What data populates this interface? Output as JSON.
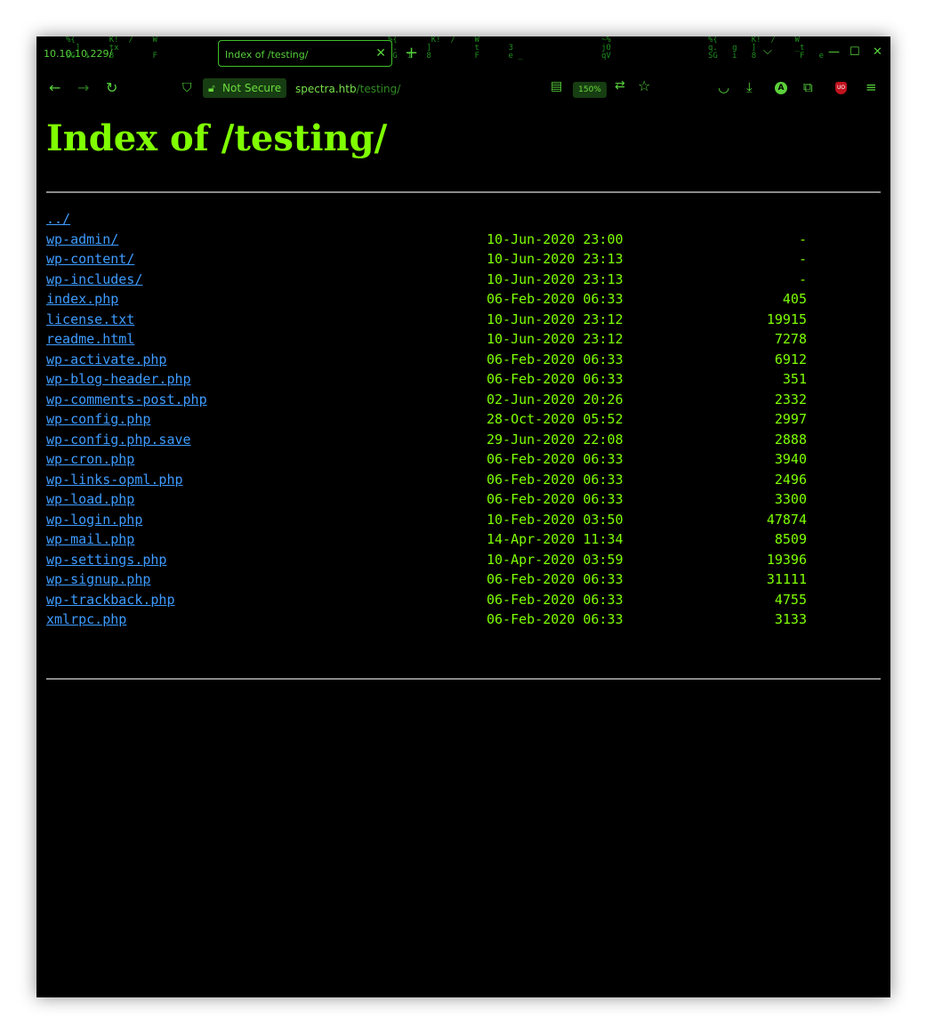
{
  "tabs": {
    "inactive_title": "10.10.10.229/",
    "active_title": "Index of /testing/"
  },
  "icons": {
    "back": "back-arrow-icon",
    "forward": "forward-arrow-icon",
    "reload": "reload-icon",
    "shield": "tracking-protection-shield-icon",
    "lock": "insecure-lock-icon",
    "reader": "reader-view-icon",
    "translate": "translate-icon",
    "bookmark": "star-icon",
    "pocket": "pocket-icon",
    "downloads": "download-icon",
    "account": "account-avatar-icon",
    "extensions": "extensions-icon",
    "ublock": "ublock-origin-icon",
    "menu": "hamburger-menu-icon"
  },
  "navbar": {
    "security_label": "Not Secure",
    "url_host": "spectra.htb",
    "url_path": "/testing/",
    "zoom": "150%",
    "avatar_letter": "A",
    "ublock_label": "UO"
  },
  "page": {
    "heading": "Index of /testing/",
    "parent_link": "../",
    "entries": [
      {
        "name": "wp-admin/",
        "date": "10-Jun-2020 23:00",
        "size": "-"
      },
      {
        "name": "wp-content/",
        "date": "10-Jun-2020 23:13",
        "size": "-"
      },
      {
        "name": "wp-includes/",
        "date": "10-Jun-2020 23:13",
        "size": "-"
      },
      {
        "name": "index.php",
        "date": "06-Feb-2020 06:33",
        "size": "405"
      },
      {
        "name": "license.txt",
        "date": "10-Jun-2020 23:12",
        "size": "19915"
      },
      {
        "name": "readme.html",
        "date": "10-Jun-2020 23:12",
        "size": "7278"
      },
      {
        "name": "wp-activate.php",
        "date": "06-Feb-2020 06:33",
        "size": "6912"
      },
      {
        "name": "wp-blog-header.php",
        "date": "06-Feb-2020 06:33",
        "size": "351"
      },
      {
        "name": "wp-comments-post.php",
        "date": "02-Jun-2020 20:26",
        "size": "2332"
      },
      {
        "name": "wp-config.php",
        "date": "28-Oct-2020 05:52",
        "size": "2997"
      },
      {
        "name": "wp-config.php.save",
        "date": "29-Jun-2020 22:08",
        "size": "2888"
      },
      {
        "name": "wp-cron.php",
        "date": "06-Feb-2020 06:33",
        "size": "3940"
      },
      {
        "name": "wp-links-opml.php",
        "date": "06-Feb-2020 06:33",
        "size": "2496"
      },
      {
        "name": "wp-load.php",
        "date": "06-Feb-2020 06:33",
        "size": "3300"
      },
      {
        "name": "wp-login.php",
        "date": "10-Feb-2020 03:50",
        "size": "47874"
      },
      {
        "name": "wp-mail.php",
        "date": "14-Apr-2020 11:34",
        "size": "8509"
      },
      {
        "name": "wp-settings.php",
        "date": "10-Apr-2020 03:59",
        "size": "19396"
      },
      {
        "name": "wp-signup.php",
        "date": "06-Feb-2020 06:33",
        "size": "31111"
      },
      {
        "name": "wp-trackback.php",
        "date": "06-Feb-2020 06:33",
        "size": "4755"
      },
      {
        "name": "xmlrpc.php",
        "date": "06-Feb-2020 06:33",
        "size": "3133"
      }
    ]
  }
}
